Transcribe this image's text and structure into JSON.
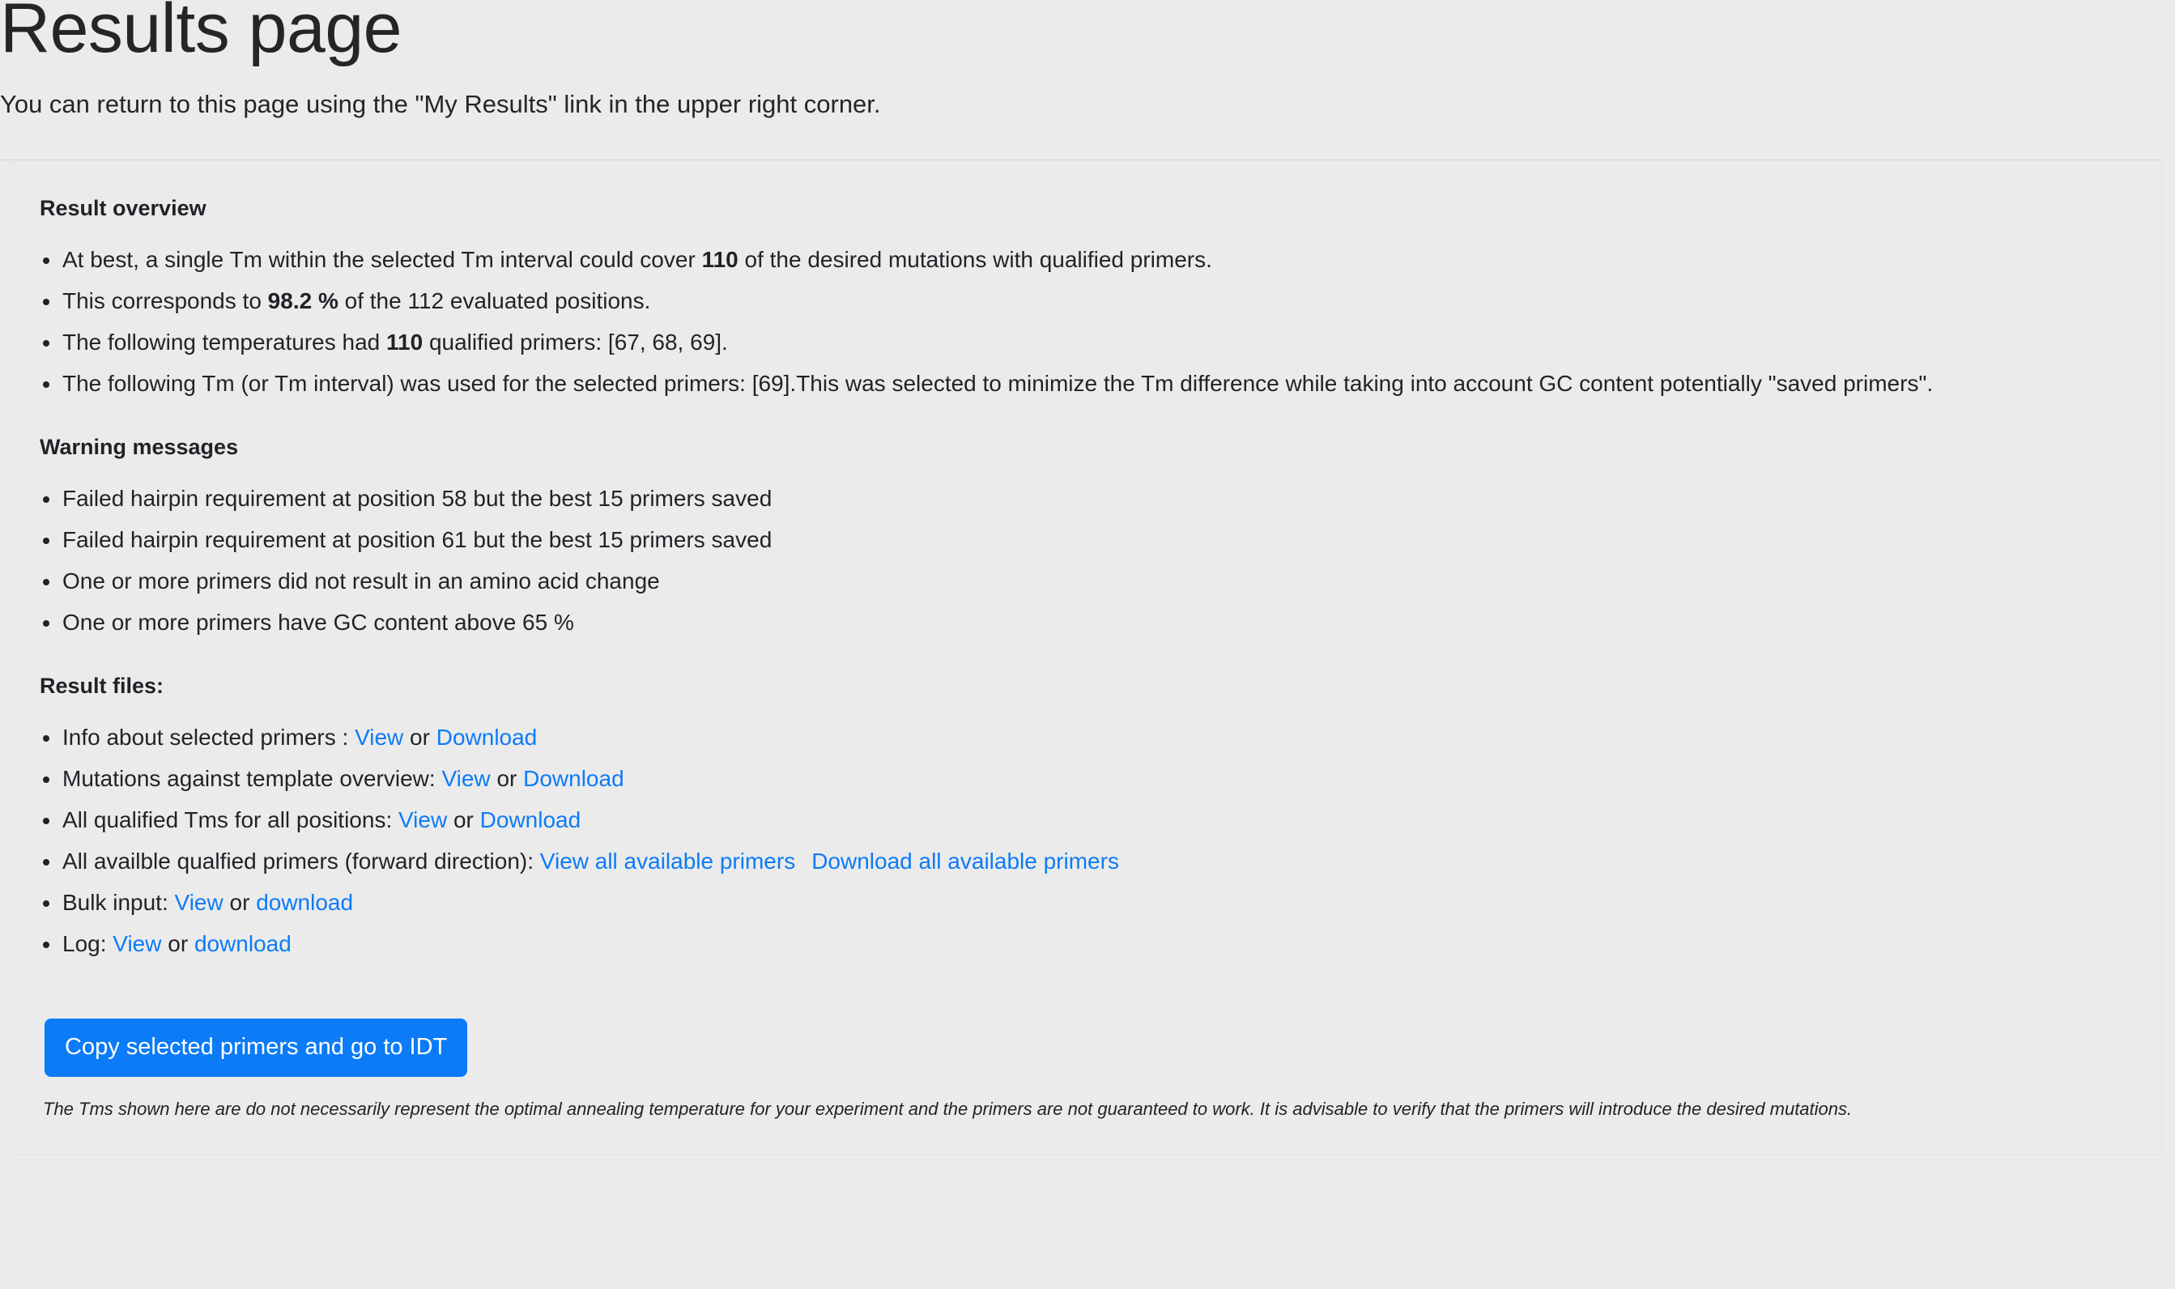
{
  "header": {
    "title": "Results page",
    "subtitle": "You can return to this page using the \"My Results\" link in the upper right corner."
  },
  "result_overview": {
    "heading": "Result overview",
    "items": [
      {
        "prefix": "At best, a single Tm within the selected Tm interval could cover ",
        "bold": "110",
        "suffix": " of the desired mutations with qualified primers."
      },
      {
        "prefix": "This corresponds to ",
        "bold": "98.2 %",
        "suffix": " of the 112 evaluated positions."
      },
      {
        "prefix": "The following temperatures had ",
        "bold": "110",
        "suffix": " qualified primers: [67, 68, 69]."
      },
      {
        "prefix": "The following Tm (or Tm interval) was used for the selected primers: [69].This was selected to minimize the Tm difference while taking into account GC content potentially \"saved primers\".",
        "bold": "",
        "suffix": ""
      }
    ]
  },
  "warnings": {
    "heading": "Warning messages",
    "items": [
      "Failed hairpin requirement at position 58 but the best 15 primers saved",
      "Failed hairpin requirement at position 61 but the best 15 primers saved",
      "One or more primers did not result in an amino acid change",
      "One or more primers have GC content above 65 %"
    ]
  },
  "result_files": {
    "heading": "Result files:",
    "separator_word": "or",
    "items": [
      {
        "label": "Info about selected primers :",
        "link1": "View",
        "sep": "or",
        "link2": "Download"
      },
      {
        "label": "Mutations against template overview:",
        "link1": "View",
        "sep": "or",
        "link2": "Download"
      },
      {
        "label": "All qualified Tms for all positions:",
        "link1": "View",
        "sep": "or",
        "link2": "Download"
      },
      {
        "label": "All availble qualfied primers (forward direction):",
        "link1": "View all available primers",
        "sep": "",
        "link2": "Download all available primers"
      },
      {
        "label": "Bulk input:",
        "link1": "View",
        "sep": "or",
        "link2": "download"
      },
      {
        "label": "Log:",
        "link1": "View",
        "sep": "or",
        "link2": "download"
      }
    ]
  },
  "actions": {
    "copy_to_idt_label": "Copy selected primers and go to IDT"
  },
  "footer": {
    "disclaimer": "The Tms shown here are do not necessarily represent the optimal annealing temperature for your experiment and the primers are not guaranteed to work. It is advisable to verify that the primers will introduce the desired mutations."
  },
  "colors": {
    "page_background": "#ebebeb",
    "link_blue": "#0d7bf7",
    "button_blue": "#0b7bf7",
    "text": "#1f2327",
    "divider": "#d8d8d8"
  }
}
